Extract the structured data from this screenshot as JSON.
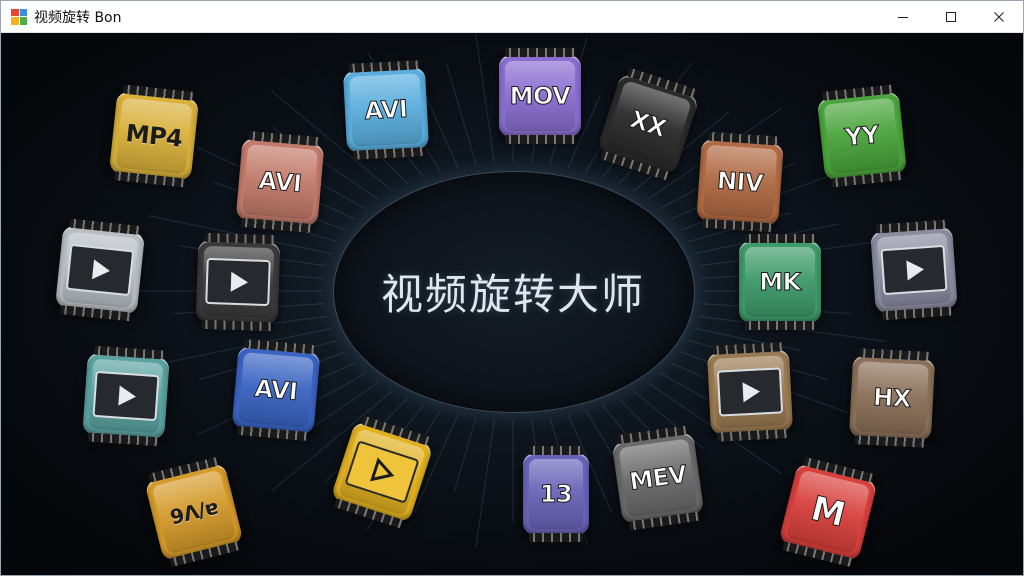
{
  "window": {
    "title": "视频旋转 Bon",
    "icon": "app-grid-icon",
    "controls": [
      "minimize-icon",
      "maximize-icon",
      "close-icon"
    ]
  },
  "main": {
    "title": "视频旋转大师"
  },
  "tiles": [
    {
      "label": "MP4",
      "icon": "",
      "color": "#d8b03a"
    },
    {
      "label": "AVI",
      "icon": "",
      "color": "#5aaede"
    },
    {
      "label": "MOV",
      "icon": "",
      "color": "#8a6ed0"
    },
    {
      "label": "XX",
      "icon": "",
      "color": "#2a2a2a"
    },
    {
      "label": "YY",
      "icon": "",
      "color": "#4aa43c"
    },
    {
      "label": "AVI",
      "icon": "",
      "color": "#c27a6a"
    },
    {
      "label": "NIV",
      "icon": "",
      "color": "#b06a44"
    },
    {
      "label": "",
      "icon": "play-icon",
      "color": "#b8bec4"
    },
    {
      "label": "",
      "icon": "play-icon",
      "color": "#3a3a3a"
    },
    {
      "label": "MK",
      "icon": "",
      "color": "#3e9a6a"
    },
    {
      "label": "",
      "icon": "play-icon",
      "color": "#8a8ca0"
    },
    {
      "label": "",
      "icon": "play-icon",
      "color": "#5aa2a0"
    },
    {
      "label": "AVI",
      "icon": "",
      "color": "#3a64c2"
    },
    {
      "label": "",
      "icon": "play-icon",
      "color": "#9a7a52"
    },
    {
      "label": "HX",
      "icon": "",
      "color": "#8a7058"
    },
    {
      "label": "",
      "icon": "play-icon",
      "color": "#e0b020"
    },
    {
      "label": "MEV",
      "icon": "",
      "color": "#6a6a6a"
    },
    {
      "label": "13",
      "icon": "",
      "color": "#6a64b8"
    },
    {
      "label": "9Ʌ/ɐ",
      "icon": "",
      "color": "#d49a2a"
    },
    {
      "label": "M",
      "icon": "",
      "color": "#d8403c"
    }
  ]
}
